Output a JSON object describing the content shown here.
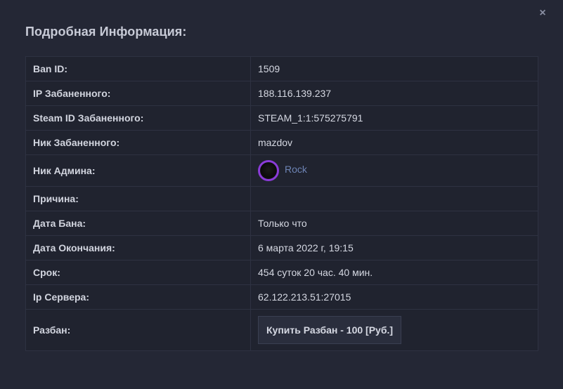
{
  "modal": {
    "title": "Подробная Информация:",
    "close_icon": "×"
  },
  "rows": [
    {
      "label": "Ban ID:",
      "value": "1509"
    },
    {
      "label": "IP Забаненного:",
      "value": "188.116.139.237"
    },
    {
      "label": "Steam ID Забаненного:",
      "value": "STEAM_1:1:575275791"
    },
    {
      "label": "Ник Забаненного:",
      "value": "mazdov"
    },
    {
      "label": "Ник Админа:",
      "value": "Rock"
    },
    {
      "label": "Причина:",
      "value": ""
    },
    {
      "label": "Дата Бана:",
      "value": "Только что"
    },
    {
      "label": "Дата Окончания:",
      "value": "6 марта 2022 г, 19:15"
    },
    {
      "label": "Срок:",
      "value": "454 суток 20 час. 40 мин."
    },
    {
      "label": "Ip Сервера:",
      "value": "62.122.213.51:27015"
    },
    {
      "label": "Разбан:",
      "value": "Купить Разбан - 100 [Руб.]"
    }
  ],
  "colors": {
    "avatar_ring": "#8a3bd8",
    "admin_link": "#6d83b4"
  }
}
